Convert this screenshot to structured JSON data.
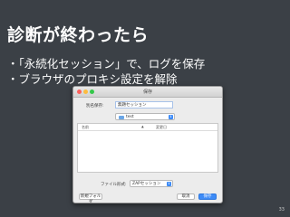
{
  "slide": {
    "title": "診断が終わったら",
    "bullets": [
      "・「永続化セッション」で、ログを保存",
      "・ブラウザのプロキシ設定を解除"
    ],
    "page_number": "33"
  },
  "dialog": {
    "title": "保存",
    "save_as_label": "別名保存:",
    "save_as_value": "無題セッション",
    "folder_value": "test",
    "list_headers": {
      "name": "名前",
      "sort_indicator": "▲",
      "date": "変更日"
    },
    "format_label": "ファイル形式:",
    "format_value": "ZAPセッション",
    "new_folder_label": "新規フォルダ",
    "cancel_label": "取消",
    "save_label": "保存"
  },
  "colors": {
    "slide_background": "#3b4046",
    "dialog_background": "#ececec",
    "accent": "#3d8bf7"
  }
}
